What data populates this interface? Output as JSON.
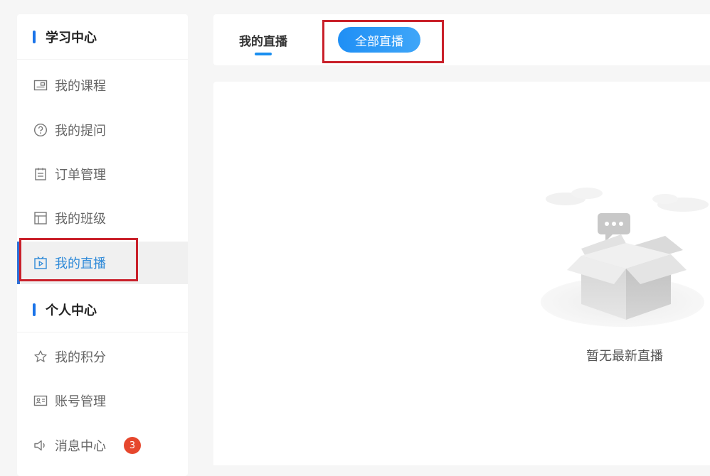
{
  "sidebar": {
    "study_section_title": "学习中心",
    "personal_section_title": "个人中心",
    "items": [
      {
        "label": "我的课程",
        "icon": "course-icon"
      },
      {
        "label": "我的提问",
        "icon": "question-icon"
      },
      {
        "label": "订单管理",
        "icon": "order-icon"
      },
      {
        "label": "我的班级",
        "icon": "class-icon"
      },
      {
        "label": "我的直播",
        "icon": "live-icon",
        "active": true
      },
      {
        "label": "我的积分",
        "icon": "points-icon"
      },
      {
        "label": "账号管理",
        "icon": "account-icon"
      },
      {
        "label": "消息中心",
        "icon": "speaker-icon",
        "badge": "3"
      }
    ]
  },
  "tabs": {
    "mine": "我的直播",
    "all": "全部直播"
  },
  "content": {
    "empty_text": "暂无最新直播",
    "illustration_icon": "empty-box-icon"
  },
  "colors": {
    "accent": "#1a8ff0",
    "active_text": "#2f8ad8",
    "badge": "#e6472d",
    "highlight": "#c9202a"
  }
}
